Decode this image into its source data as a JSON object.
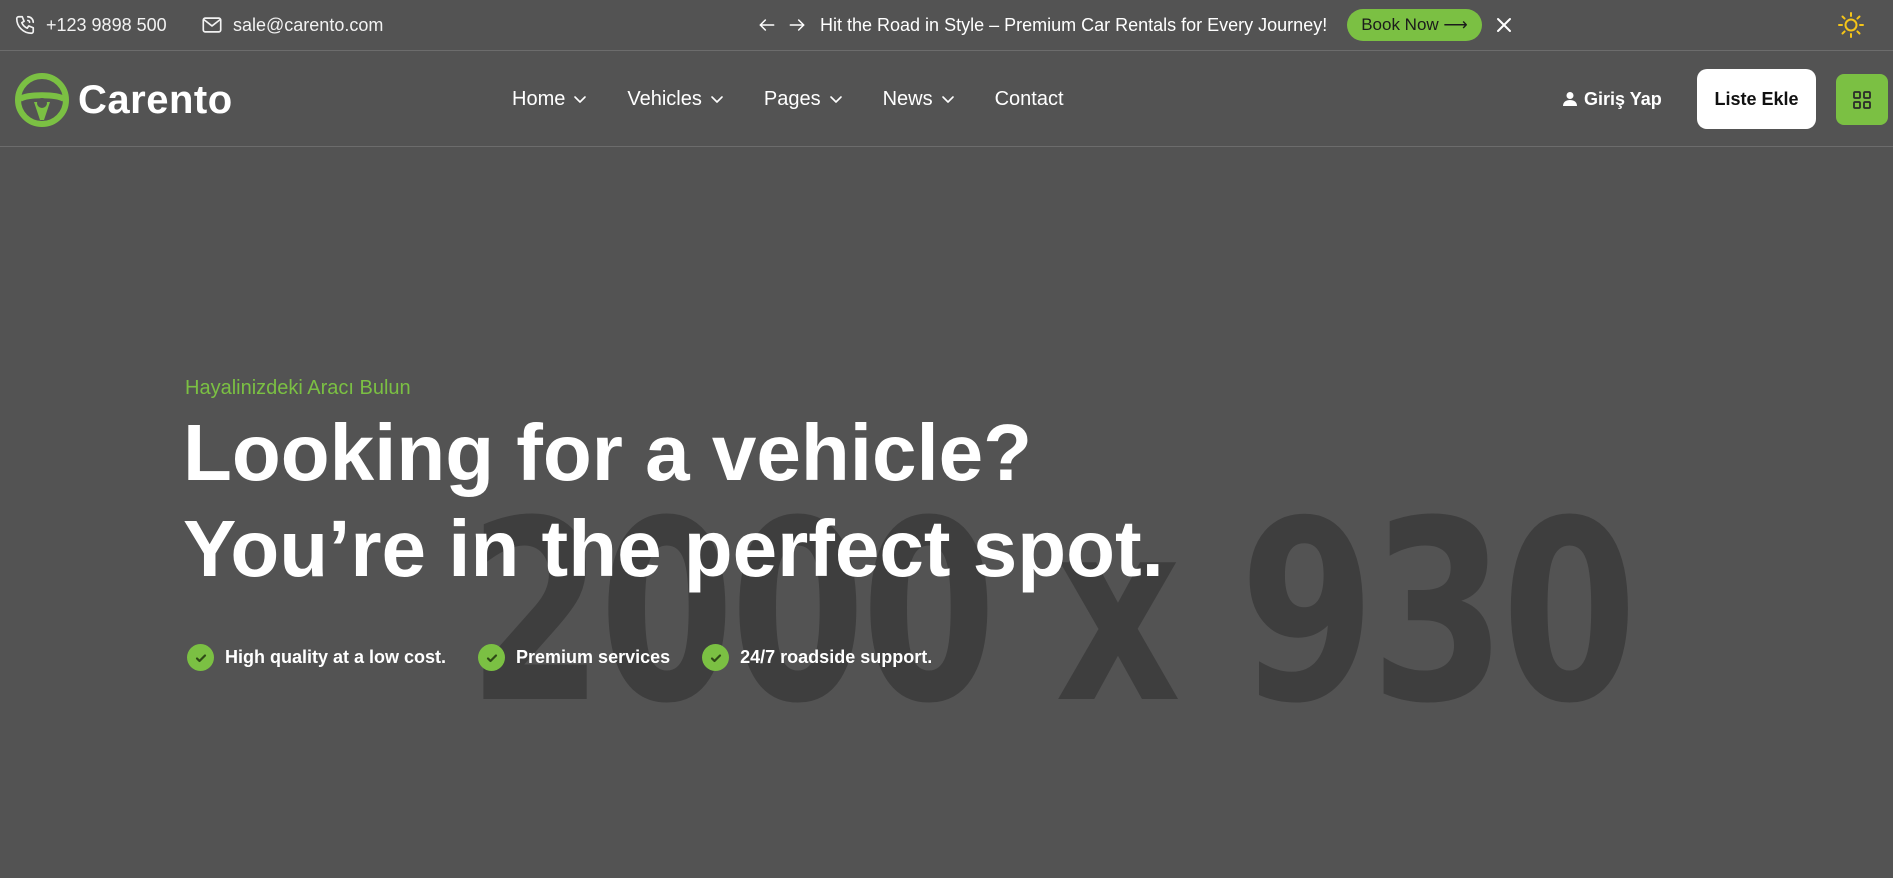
{
  "topbar": {
    "phone": "+123 9898 500",
    "email": "sale@carento.com",
    "promo_text": "Hit the Road in Style – Premium Car Rentals for Every Journey!",
    "book_label": "Book Now ⟶"
  },
  "nav": {
    "logo_text": "Carento",
    "items": [
      {
        "label": "Home",
        "has_dropdown": true
      },
      {
        "label": "Vehicles",
        "has_dropdown": true
      },
      {
        "label": "Pages",
        "has_dropdown": true
      },
      {
        "label": "News",
        "has_dropdown": true
      },
      {
        "label": "Contact",
        "has_dropdown": false
      }
    ],
    "login_label": "Giriş Yap",
    "list_label": "Liste Ekle"
  },
  "hero": {
    "placeholder_text": "2000 x 930",
    "eyebrow": "Hayalinizdeki Aracı Bulun",
    "headline_line1": "Looking for a vehicle?",
    "headline_line2": "You’re in the perfect spot.",
    "features": [
      "High quality at a low cost.",
      "Premium services",
      "24/7 roadside support."
    ]
  },
  "colors": {
    "background": "#535353",
    "accent": "#7bc043",
    "sun_icon": "#f5c518"
  },
  "icons": {
    "phone": "phone-icon",
    "email": "mail-icon",
    "prev": "arrow-left-icon",
    "next": "arrow-right-icon",
    "close": "close-icon",
    "theme": "sun-icon",
    "logo": "steering-wheel-icon",
    "user": "user-icon",
    "grid": "grid-icon",
    "check": "check-icon"
  }
}
